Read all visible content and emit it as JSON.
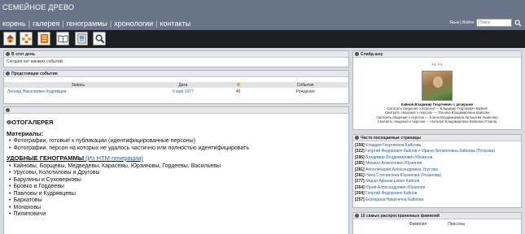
{
  "header": {
    "site_title": "СЕМЕЙНОЕ ДРЕВО",
    "nav": [
      "корень",
      "галерея",
      "генограммы",
      "хронологии",
      "контакты"
    ],
    "lang_links": "Язык | Войти",
    "search_placeholder": "Поиск"
  },
  "toolbar": {
    "icons": [
      "home-icon",
      "family-icon",
      "book-icon",
      "open-book-icon",
      "photo-album-icon",
      "magnifier-icon"
    ]
  },
  "today": {
    "title": "В этот день",
    "text": "Сегодня нет никаких событий."
  },
  "upcoming": {
    "title": "Предстоящие события",
    "columns": [
      "Запись",
      "Дата",
      "",
      "Событие"
    ],
    "row": {
      "name": "Леонид Николаевич Кудрявцев",
      "date": "6 мая 1977",
      "age": "46",
      "event": "Рождения"
    }
  },
  "gallery": {
    "title": "ФОТОГАЛЕРЕЯ",
    "materials": "Материалы:",
    "material_items": [
      "Фотографии, готовые к публикации (идентифицированные персоны)",
      "Фотографии, персон на которых не удалось частично или полностью идентифицировать"
    ],
    "genograms_heading": "УДОБНЫЕ ГЕНОГРАММЫ",
    "genograms_note": "(Из HTM-генерации)",
    "genograms": [
      "Кайновы, Борщевы, Медведевы, Карасевы, Юрзиновы, Гордеевы, Васильевы",
      "Урусовы, Колотиловы и Друговы",
      "Барулины и Суховерковы",
      "Бровко и Гордеевы",
      "Павловы и Кудрявцевы",
      "Бархатовы",
      "Монаховы",
      "Пилиповичи"
    ]
  },
  "slideshow": {
    "title": "Слайд-шоу",
    "nav": "<<  >>",
    "name": "Кайнов Владимир Георгиевич с дочерьми",
    "lines": [
      "Смотреть сведения о персоне — Владимир Георгиевич Кайнов",
      "Смотреть сведения о персоне — Татьяна Владимировна Кайнова",
      "Смотреть сведения о персоне — Елена Владимировна Латышева (Кайнова)",
      "Смотреть сведения о персоне — Наталья Владимировна Кайнова (Уткина)"
    ]
  },
  "visited": {
    "title": "Часто посещаемые страницы",
    "items": [
      {
        "count": "[358]",
        "name": "Клавдия Георгиевна Кайнова"
      },
      {
        "count": "[322]",
        "name": "Георгий Федорович Кайнов + Ирина Филипповна Кайнова (Петрова)"
      },
      {
        "count": "[286]",
        "name": "Владимир Владимирович Юрзинов"
      },
      {
        "count": "[285]",
        "name": "Михаил Алексеевич Юрзинов"
      },
      {
        "count": "[281]",
        "name": "Аполлинария Александровна Урусова"
      },
      {
        "count": "[281]",
        "name": "Нина Степановна Юрзинова (Розанова)"
      },
      {
        "count": "[277]",
        "name": "Федор Афанасьевич Кайнов"
      },
      {
        "count": "[264]",
        "name": "Юрий Александрович Юрзинов"
      },
      {
        "count": "[264]",
        "name": "Георгий Федорович Кайнов"
      },
      {
        "count": "[257]",
        "name": "Екатерина Никитична Кайнова"
      }
    ]
  },
  "surnames": {
    "title": "10 самых распространенных фамилий",
    "columns": [
      "Фамилия",
      "Персоны"
    ]
  }
}
